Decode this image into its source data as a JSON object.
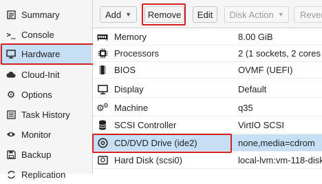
{
  "sidebar": {
    "items": [
      {
        "label": "Summary",
        "icon": "summary-icon"
      },
      {
        "label": "Console",
        "icon": "console-icon"
      },
      {
        "label": "Hardware",
        "icon": "monitor-icon",
        "selected": true
      },
      {
        "label": "Cloud-Init",
        "icon": "cloud-icon"
      },
      {
        "label": "Options",
        "icon": "gear-icon"
      },
      {
        "label": "Task History",
        "icon": "list-icon"
      },
      {
        "label": "Monitor",
        "icon": "eye-icon"
      },
      {
        "label": "Backup",
        "icon": "floppy-icon"
      },
      {
        "label": "Replication",
        "icon": "refresh-icon"
      }
    ]
  },
  "toolbar": {
    "add_label": "Add",
    "remove_label": "Remove",
    "edit_label": "Edit",
    "disk_action_label": "Disk Action",
    "revert_label": "Rever"
  },
  "hardware": {
    "rows": [
      {
        "name": "Memory",
        "value": "8.00 GiB",
        "icon": "memory-icon"
      },
      {
        "name": "Processors",
        "value": "2 (1 sockets, 2 cores",
        "icon": "cpu-icon"
      },
      {
        "name": "BIOS",
        "value": "OVMF (UEFI)",
        "icon": "chip-icon"
      },
      {
        "name": "Display",
        "value": "Default",
        "icon": "display-icon"
      },
      {
        "name": "Machine",
        "value": "q35",
        "icon": "gears-icon"
      },
      {
        "name": "SCSI Controller",
        "value": "VirtIO SCSI",
        "icon": "database-icon"
      },
      {
        "name": "CD/DVD Drive (ide2)",
        "value": "none,media=cdrom",
        "icon": "cdrom-icon",
        "selected": true
      },
      {
        "name": "Hard Disk (scsi0)",
        "value": "local-lvm:vm-118-disk",
        "icon": "harddisk-icon"
      }
    ]
  },
  "colors": {
    "highlight_border": "#d32121",
    "selection": "#c6dff5"
  }
}
